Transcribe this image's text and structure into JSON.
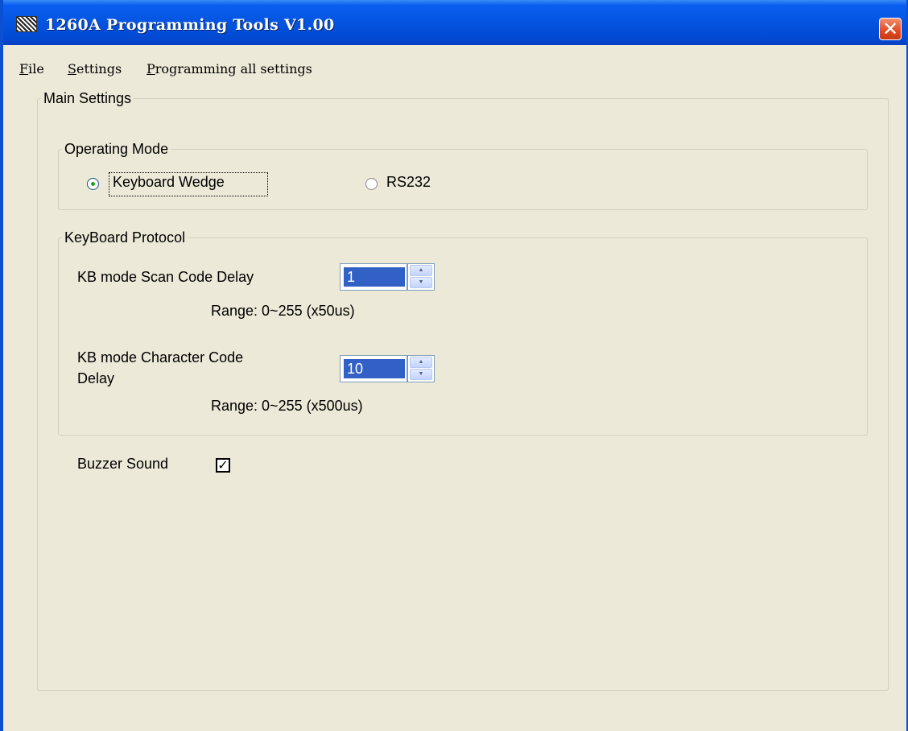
{
  "window": {
    "title": "1260A Programming Tools V1.00",
    "close_glyph": "✕"
  },
  "menu": {
    "file": "File",
    "settings": "Settings",
    "programming_all": "Programming all settings"
  },
  "main_settings": {
    "legend": "Main Settings",
    "operating_mode": {
      "legend": "Operating Mode",
      "options": [
        {
          "label": "Keyboard Wedge",
          "selected": true
        },
        {
          "label": "RS232",
          "selected": false
        }
      ]
    },
    "keyboard_protocol": {
      "legend": "KeyBoard Protocol",
      "scan_code_delay": {
        "label": "KB mode Scan Code Delay",
        "value": "1",
        "range": "Range: 0~255 (x50us)"
      },
      "char_code_delay": {
        "label_line1": "KB mode Character Code",
        "label_line2": "Delay",
        "value": "10",
        "range": "Range: 0~255 (x500us)"
      }
    },
    "buzzer": {
      "label": "Buzzer Sound",
      "checked": true,
      "check_glyph": "✓"
    }
  },
  "colors": {
    "titlebar": "#0454e0",
    "window_bg": "#ece9d8",
    "selection": "#3161c5",
    "close_button": "#e04a22"
  },
  "icons": {
    "app": "app-icon",
    "close": "close-icon",
    "spin_up": "spin-up-arrow-icon",
    "spin_down": "spin-down-arrow-icon",
    "check": "check-icon"
  }
}
